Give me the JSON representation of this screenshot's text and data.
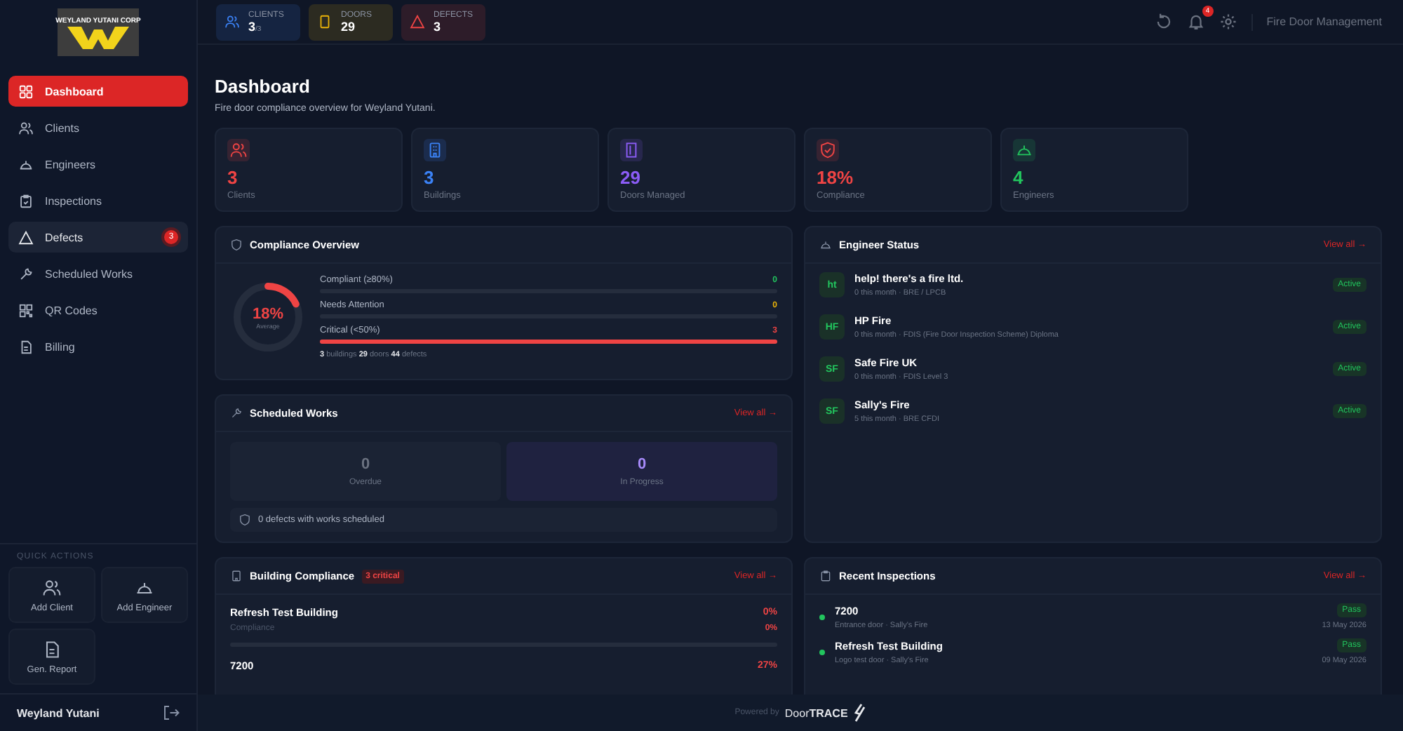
{
  "sidebar": {
    "logo_text": "WEYLAND YUTANI CORP",
    "nav": [
      {
        "label": "Dashboard",
        "selected": true,
        "hovered": false
      },
      {
        "label": "Clients",
        "selected": false,
        "hovered": false
      },
      {
        "label": "Engineers",
        "selected": false,
        "hovered": false
      },
      {
        "label": "Inspections",
        "selected": false,
        "hovered": false
      },
      {
        "label": "Defects",
        "selected": false,
        "hovered": true,
        "badge": "3"
      },
      {
        "label": "Scheduled Works",
        "selected": false,
        "hovered": false
      },
      {
        "label": "QR Codes",
        "selected": false,
        "hovered": false
      },
      {
        "label": "Billing",
        "selected": false,
        "hovered": false
      }
    ],
    "quick_actions_title": "QUICK ACTIONS",
    "quick_actions": [
      {
        "label": "Add Client"
      },
      {
        "label": "Add Engineer"
      },
      {
        "label": "Gen. Report"
      }
    ],
    "user_name": "Weyland Yutani"
  },
  "topbar": {
    "chips": [
      {
        "label": "CLIENTS",
        "value": "3",
        "total": "/3",
        "color": "#3b82f6"
      },
      {
        "label": "DOORS",
        "value": "29",
        "color": "#eab308"
      },
      {
        "label": "DEFECTS",
        "value": "3",
        "color": "#ef4444"
      }
    ],
    "notification_count": "4",
    "title": "Fire Door Management"
  },
  "page": {
    "title": "Dashboard",
    "subtitle": "Fire door compliance overview for Weyland Yutani."
  },
  "stat_cards": [
    {
      "value": "3",
      "label": "Clients",
      "color": "#ef4444"
    },
    {
      "value": "3",
      "label": "Buildings",
      "color": "#3b82f6"
    },
    {
      "value": "29",
      "label": "Doors Managed",
      "color": "#8b5cf6"
    },
    {
      "value": "18%",
      "label": "Compliance",
      "color": "#ef4444"
    },
    {
      "value": "4",
      "label": "Engineers",
      "color": "#22c55e"
    }
  ],
  "compliance_overview": {
    "title": "Compliance Overview",
    "average": "18%",
    "average_label": "Average",
    "level": 0.18,
    "rows": [
      {
        "label": "Compliant (≥80%)",
        "count": "0",
        "level": 0,
        "color": "#22c55e"
      },
      {
        "label": "Needs Attention",
        "count": "0",
        "level": 0,
        "color": "#eab308"
      },
      {
        "label": "Critical (<50%)",
        "count": "3",
        "level": 1,
        "color": "#ef4444"
      }
    ],
    "summary": "**3** buildings  **29** doors  **44** defects"
  },
  "scheduled_works": {
    "title": "Scheduled Works",
    "view_all": "View all →",
    "tiles": [
      {
        "value": "0",
        "label": "Overdue",
        "kind": "overdue"
      },
      {
        "value": "0",
        "label": "In Progress",
        "kind": "progress"
      }
    ],
    "note": "0 defects with works scheduled"
  },
  "building_compliance": {
    "title": "Building Compliance",
    "badge": "3 critical",
    "view_all": "View all →",
    "rows": [
      {
        "name": "Refresh Test Building",
        "percent": "0%",
        "sub_label": "Compliance",
        "sub_percent": "0%",
        "level": 0
      },
      {
        "name": "7200",
        "percent": "27%"
      }
    ]
  },
  "engineer_status": {
    "title": "Engineer Status",
    "view_all": "View all →",
    "engineers": [
      {
        "initials": "ht",
        "name": "help! there's a fire ltd.",
        "details": "0 this month · BRE / LPCB",
        "status": "Active"
      },
      {
        "initials": "HF",
        "name": "HP Fire",
        "details": "0 this month · FDIS (Fire Door Inspection Scheme) Diploma",
        "status": "Active"
      },
      {
        "initials": "SF",
        "name": "Safe Fire UK",
        "details": "0 this month · FDIS Level 3",
        "status": "Active"
      },
      {
        "initials": "SF",
        "name": "Sally's Fire",
        "details": "5 this month · BRE CFDI",
        "status": "Active"
      }
    ]
  },
  "recent_inspections": {
    "title": "Recent Inspections",
    "view_all": "View all →",
    "items": [
      {
        "name": "7200",
        "details": "Entrance door · Sally's Fire",
        "result": "Pass",
        "date": "13 May 2026"
      },
      {
        "name": "Refresh Test Building",
        "details": "Logo test door · Sally's Fire",
        "result": "Pass",
        "date": "09 May 2026"
      }
    ]
  },
  "footer": {
    "powered_by": "Powered by",
    "brand": "Door**TRACE**"
  }
}
